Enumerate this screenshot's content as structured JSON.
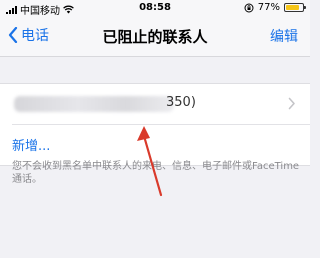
{
  "status_bar": {
    "carrier": "中国移动",
    "time": "08:58",
    "battery": "77%",
    "battery_color": "#f5c518",
    "battery_level": 0.77
  },
  "nav": {
    "back_label": "电话",
    "title": "已阻止的联系人",
    "edit_label": "编辑"
  },
  "list": {
    "blocked_number_tail": "350)",
    "add_label": "新增..."
  },
  "footer": {
    "note": "您不会收到黑名单中联系人的来电、信息、电子邮件或FaceTime通话。"
  },
  "colors": {
    "accent": "#1a73e8",
    "annotation_arrow": "#d93a2b"
  }
}
